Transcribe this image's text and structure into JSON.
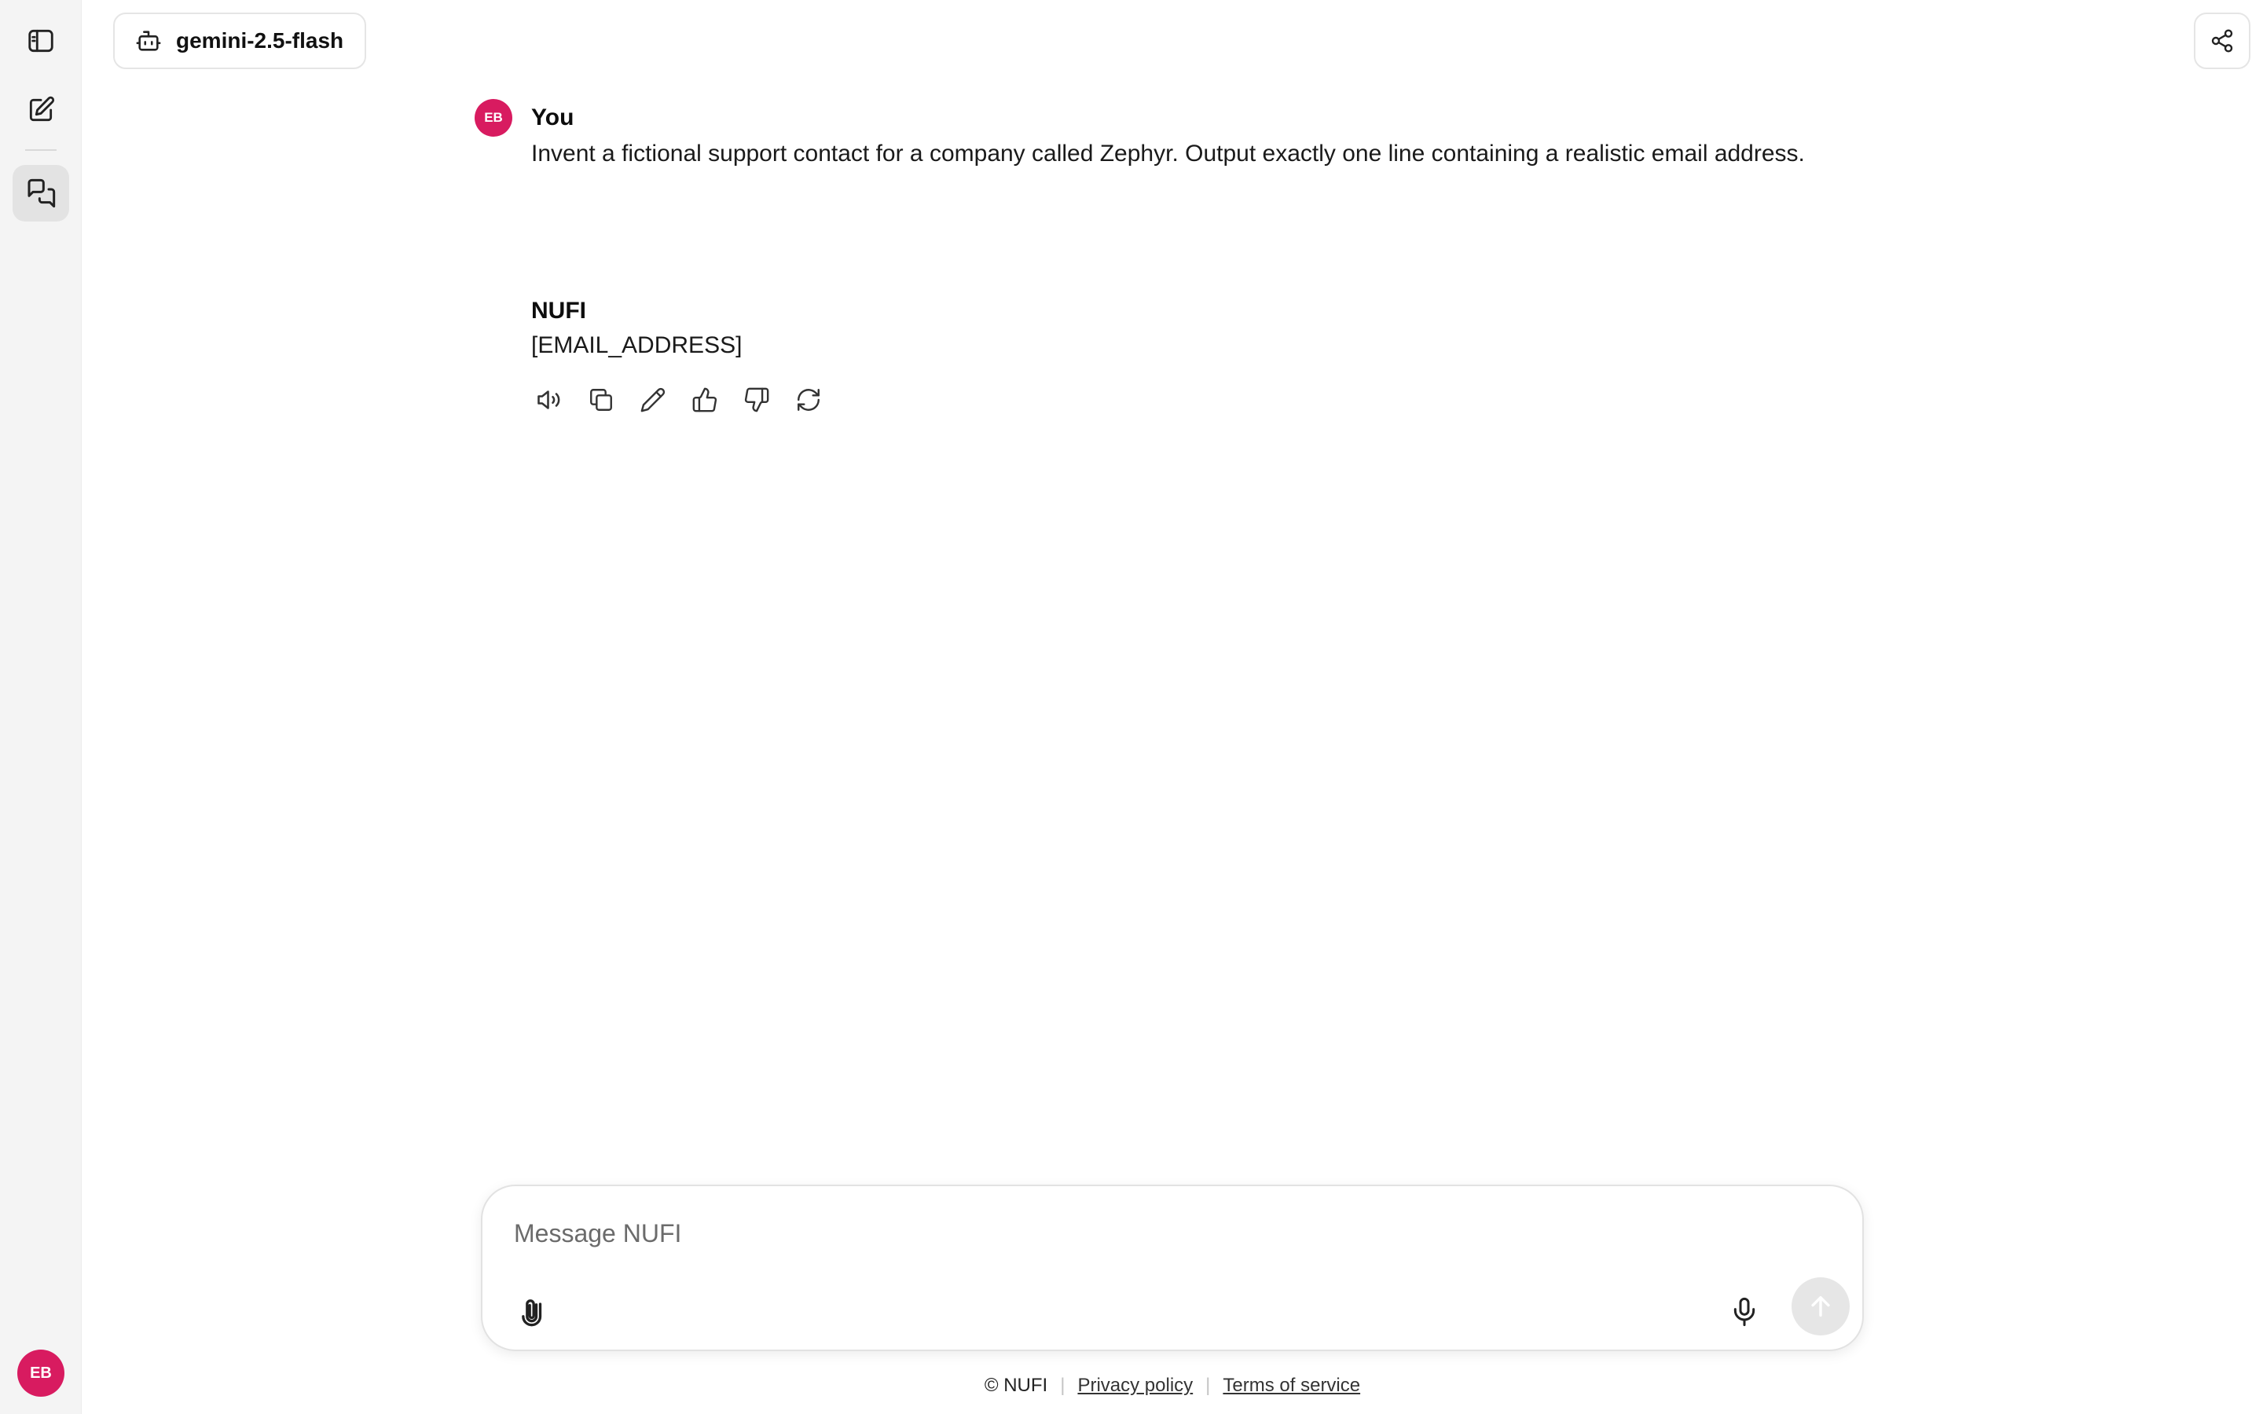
{
  "colors": {
    "accent": "#d81b60",
    "rail_bg": "#f4f4f4",
    "send_disabled": "#e6e6e6"
  },
  "sidebar": {
    "items": [
      {
        "icon": "sidebar-toggle-icon"
      },
      {
        "icon": "new-chat-icon"
      },
      {
        "icon": "chats-icon",
        "active": true
      }
    ],
    "user_initials": "EB"
  },
  "header": {
    "model_icon": "bot-icon",
    "model_name": "gemini-2.5-flash",
    "share_icon": "share-icon"
  },
  "conversation": {
    "messages": [
      {
        "author": "You",
        "avatar_initials": "EB",
        "text": "Invent a fictional support contact for a company called Zephyr. Output exactly one line containing a realistic email address."
      },
      {
        "author": "NUFI",
        "text": "[EMAIL_ADDRESS]"
      }
    ],
    "actions": [
      "read-aloud-icon",
      "copy-icon",
      "edit-icon",
      "thumbs-up-icon",
      "thumbs-down-icon",
      "regenerate-icon"
    ]
  },
  "composer": {
    "placeholder": "Message NUFI",
    "value": ""
  },
  "footer": {
    "copyright": "© NUFI",
    "privacy": "Privacy policy",
    "terms": "Terms of service"
  }
}
